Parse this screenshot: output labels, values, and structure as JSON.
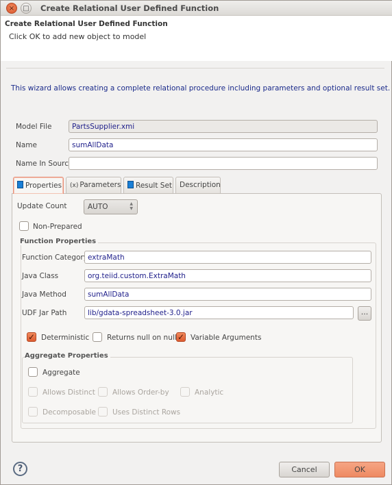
{
  "window": {
    "title": "Create Relational User Defined Function",
    "close_icon": "×",
    "maximize_icon": "□"
  },
  "header": {
    "title": "Create Relational User Defined Function",
    "message": "Click OK to add new object to model"
  },
  "intro": "This wizard allows creating a complete relational procedure including parameters and optional result set.",
  "fields": {
    "model_file": {
      "label": "Model File",
      "value": "PartsSupplier.xmi"
    },
    "name": {
      "label": "Name",
      "value": "sumAllData"
    },
    "name_in_source": {
      "label": "Name In Source",
      "value": ""
    }
  },
  "tabs": [
    {
      "label": "Properties",
      "icon": "table-icon"
    },
    {
      "label": "Parameters",
      "icon": "(x)"
    },
    {
      "label": "Result Set",
      "icon": "table-icon"
    },
    {
      "label": "Description"
    }
  ],
  "properties": {
    "update_count": {
      "label": "Update Count",
      "value": "AUTO"
    },
    "non_prepared": {
      "label": "Non-Prepared",
      "checked": false
    },
    "function_properties": {
      "title": "Function Properties",
      "category": {
        "label": "Function Category",
        "value": "extraMath"
      },
      "java_class": {
        "label": "Java Class",
        "value": "org.teiid.custom.ExtraMath"
      },
      "java_method": {
        "label": "Java Method",
        "value": "sumAllData"
      },
      "udf_jar": {
        "label": "UDF Jar Path",
        "value": "lib/gdata-spreadsheet-3.0.jar",
        "browse": "..."
      },
      "deterministic": {
        "label": "Deterministic",
        "checked": true
      },
      "returns_null": {
        "label": "Returns null on null",
        "checked": false
      },
      "variable_args": {
        "label": "Variable Arguments",
        "checked": true
      }
    },
    "aggregate": {
      "title": "Aggregate Properties",
      "aggregate": {
        "label": "Aggregate",
        "checked": false
      },
      "allows_distinct": {
        "label": "Allows Distinct",
        "checked": false,
        "enabled": false
      },
      "allows_order_by": {
        "label": "Allows Order-by",
        "checked": false,
        "enabled": false
      },
      "analytic": {
        "label": "Analytic",
        "checked": false,
        "enabled": false
      },
      "decomposable": {
        "label": "Decomposable",
        "checked": false,
        "enabled": false
      },
      "uses_distinct_rows": {
        "label": "Uses Distinct Rows",
        "checked": false,
        "enabled": false
      }
    }
  },
  "footer": {
    "help": "?",
    "cancel": "Cancel",
    "ok": "OK"
  },
  "colors": {
    "accent": "#ee8a62",
    "intro_text": "#1a2a8a",
    "field_text": "#1e1e8a"
  }
}
